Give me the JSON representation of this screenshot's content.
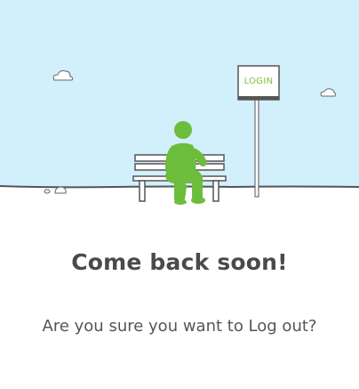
{
  "illustration": {
    "sign_label": "LOGIN",
    "colors": {
      "sky": "#d2effc",
      "person": "#6cbd3b",
      "outline": "#555555",
      "sign_text": "#7cc142"
    }
  },
  "dialog": {
    "title": "Come back soon!",
    "message": "Are you sure you want to Log out?"
  }
}
